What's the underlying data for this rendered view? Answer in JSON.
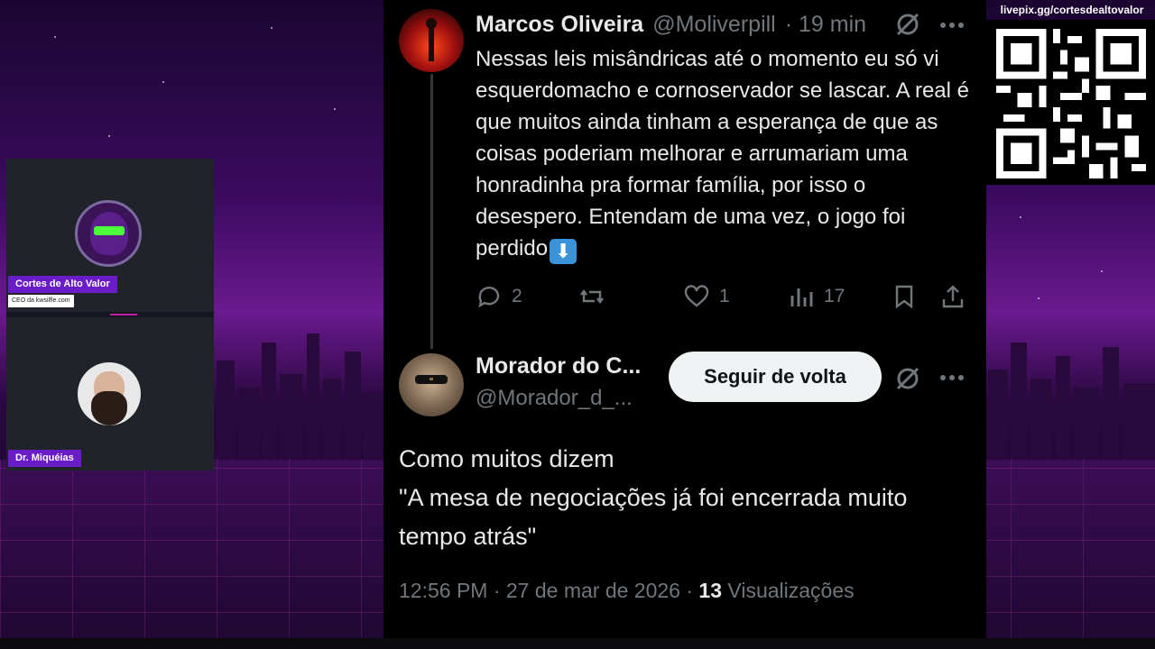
{
  "tweet1": {
    "name": "Marcos Oliveira",
    "handle": "@Moliverpill",
    "time": "· 19 min",
    "body": "Nessas leis misândricas até o momento eu só vi esquerdomacho e cornoservador se lascar. A real é que muitos ainda tinham a esperança de que as coisas poderiam melhorar e arrumariam uma honradinha pra formar família, por isso o desespero. Entendam de uma vez, o jogo foi perdido",
    "emoji": "⬇",
    "replies": "2",
    "likes": "1",
    "views": "17"
  },
  "tweet2": {
    "name": "Morador do C...",
    "handle": "@Morador_d_...",
    "follow_label": "Seguir de volta",
    "text_line1": "Como muitos dizem",
    "text_line2": "\"A mesa de negociações já foi encerrada muito tempo atrás\"",
    "timestamp": "12:56 PM · 27 de mar de 2026 ·",
    "views_count": "13",
    "views_label": "Visualizações"
  },
  "cam1": {
    "name": "Cortes de Alto Valor",
    "subtitle": "CEO da kwsilfle.com"
  },
  "cam2": {
    "name": "Dr. Miquéias"
  },
  "qr": {
    "url": "livepix.gg/cortesdealtovalor"
  },
  "colors": {
    "accent": "#6a1cc9",
    "tweet_bg": "#000000",
    "muted": "#71767b",
    "button_bg": "#eff3f4"
  }
}
